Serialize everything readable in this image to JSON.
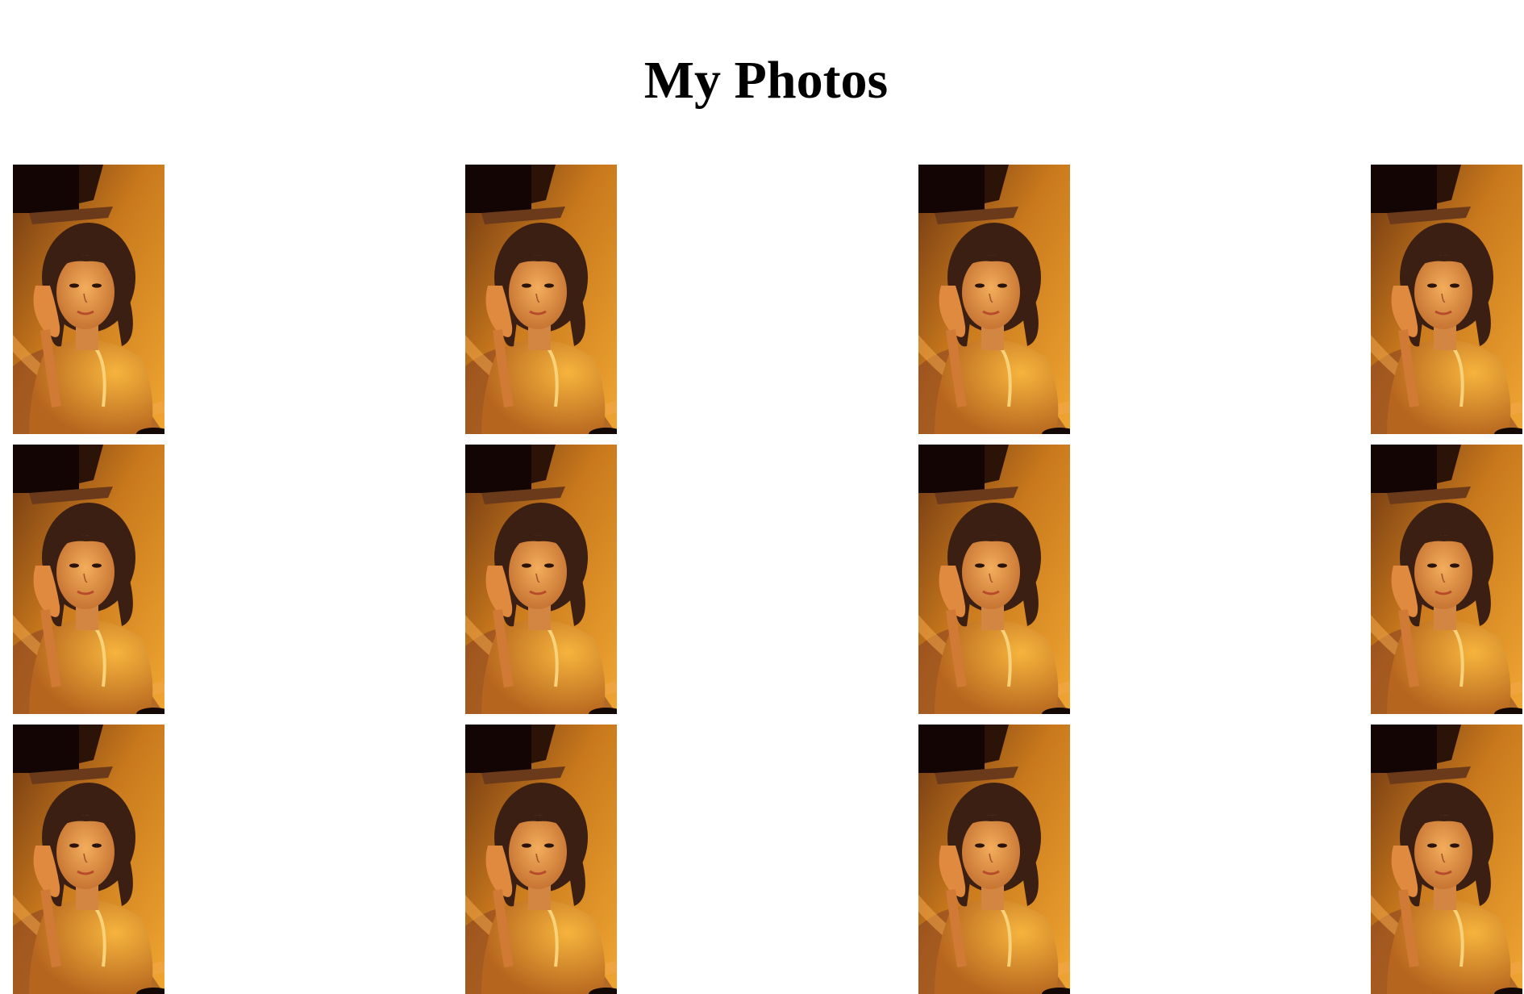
{
  "page": {
    "title": "My Photos"
  },
  "gallery": {
    "photos": [
      {
        "subject": "portrait"
      },
      {
        "subject": "portrait"
      },
      {
        "subject": "portrait"
      },
      {
        "subject": "portrait"
      },
      {
        "subject": "portrait"
      },
      {
        "subject": "portrait"
      },
      {
        "subject": "portrait"
      },
      {
        "subject": "portrait"
      },
      {
        "subject": "portrait"
      },
      {
        "subject": "portrait"
      },
      {
        "subject": "portrait"
      },
      {
        "subject": "portrait"
      }
    ]
  },
  "colors": {
    "background": "#ffffff",
    "title": "#000000",
    "photo_warm_light": "#f0a632",
    "photo_shadow": "#3a1d10",
    "photo_skin": "#e69a4f",
    "photo_hair": "#3b1f12"
  }
}
